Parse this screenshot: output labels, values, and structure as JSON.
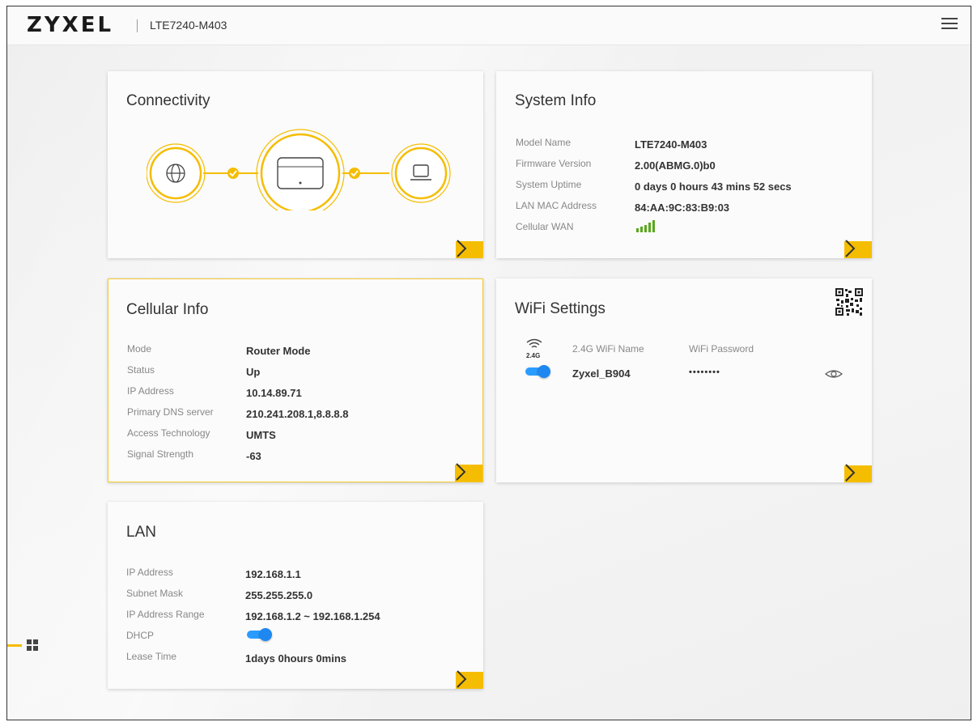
{
  "header": {
    "logo": "ZYXEL",
    "model": "LTE7240-M403",
    "menu_icon": "hamburger-menu-icon"
  },
  "connectivity": {
    "title": "Connectivity",
    "nodes": [
      "globe-icon",
      "router-icon",
      "laptop-icon"
    ],
    "accent_color": "#f5bd00"
  },
  "system_info": {
    "title": "System Info",
    "rows": [
      {
        "label": "Model Name",
        "value": "LTE7240-M403"
      },
      {
        "label": "Firmware Version",
        "value": "2.00(ABMG.0)b0"
      },
      {
        "label": "System Uptime",
        "value": "0 days 0 hours 43 mins 52 secs"
      },
      {
        "label": "LAN MAC Address",
        "value": "84:AA:9C:83:B9:03"
      },
      {
        "label": "Cellular WAN",
        "value": ""
      }
    ],
    "signal_bars_active": 5,
    "signal_color": "#5aa81e"
  },
  "cellular_info": {
    "title": "Cellular Info",
    "rows": [
      {
        "label": "Mode",
        "value": "Router Mode"
      },
      {
        "label": "Status",
        "value": "Up"
      },
      {
        "label": "IP Address",
        "value": "10.14.89.71"
      },
      {
        "label": "Primary DNS server",
        "value": "210.241.208.1,8.8.8.8"
      },
      {
        "label": "Access Technology",
        "value": "UMTS"
      },
      {
        "label": "Signal Strength",
        "value": "-63"
      }
    ]
  },
  "wifi_settings": {
    "title": "WiFi Settings",
    "band": "2.4G",
    "name_label": "2.4G WiFi Name",
    "password_label": "WiFi Password",
    "ssid": "Zyxel_B904",
    "password_mask": "••••••••",
    "enabled": true
  },
  "lan": {
    "title": "LAN",
    "rows": [
      {
        "label": "IP Address",
        "value": "192.168.1.1"
      },
      {
        "label": "Subnet Mask",
        "value": "255.255.255.0"
      },
      {
        "label": "IP Address Range",
        "value": "192.168.1.2 ~ 192.168.1.254"
      },
      {
        "label": "DHCP",
        "value": ""
      },
      {
        "label": "Lease Time",
        "value": "1days 0hours 0mins"
      }
    ],
    "dhcp_enabled": true
  },
  "colors": {
    "accent": "#f5bd00",
    "toggle": "#1e88f0"
  }
}
